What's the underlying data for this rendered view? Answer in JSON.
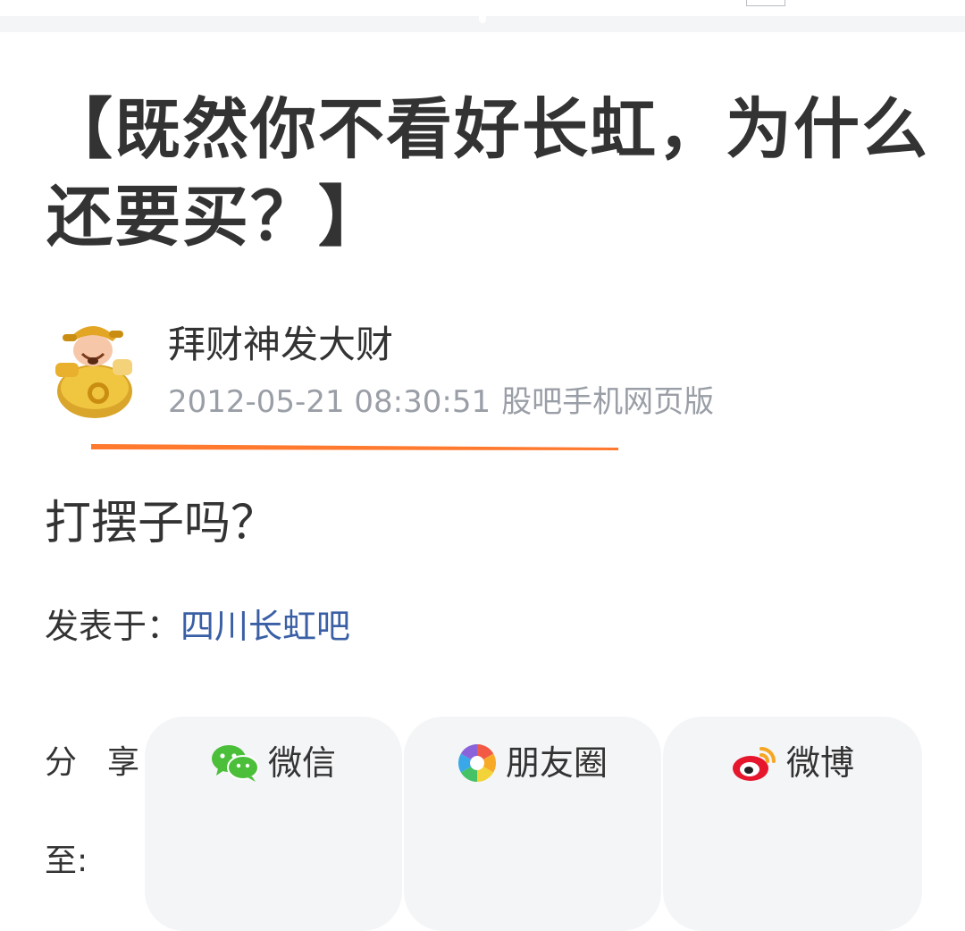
{
  "post": {
    "title": "【既然你不看好长虹，为什么还要买？】",
    "author": "拜财神发大财",
    "datetime": "2012-05-21 08:30:51",
    "source": "股吧手机网页版",
    "content": "打摆子吗？",
    "posted_in_label": "发表于：",
    "posted_in_forum": "四川长虹吧"
  },
  "share": {
    "label_line1": "分享",
    "label_line2": "至:",
    "buttons": [
      {
        "label": "微信",
        "icon": "wechat-icon"
      },
      {
        "label": "朋友圈",
        "icon": "moments-icon"
      },
      {
        "label": "微博",
        "icon": "weibo-icon"
      }
    ]
  },
  "colors": {
    "link": "#3a5fa5",
    "underline_mark": "#ff7a2f",
    "meta_text": "#9a9ea6",
    "button_bg": "#f4f5f7"
  }
}
